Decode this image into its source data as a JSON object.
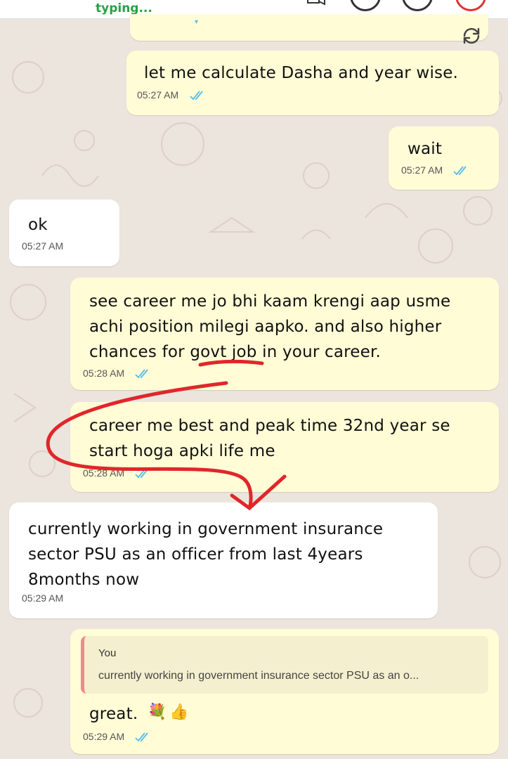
{
  "header": {
    "status": "typing..."
  },
  "colors": {
    "outgoing": "#fffcd6",
    "incoming": "#ffffff",
    "ticks": "#53bdeb",
    "annotation": "#e0262b",
    "typing": "#25a244"
  },
  "messages": [
    {
      "direction": "out",
      "text": "let me calculate Dasha and year wise.",
      "time": "05:27 AM",
      "status": "read"
    },
    {
      "direction": "out",
      "text": "wait",
      "time": "05:27 AM",
      "status": "read"
    },
    {
      "direction": "in",
      "text": "ok",
      "time": "05:27 AM"
    },
    {
      "direction": "out",
      "text": "see career me jo bhi kaam krengi aap usme\nachi position milegi aapko. and also higher\nchances for govt job in your career.",
      "time": "05:28 AM",
      "status": "read"
    },
    {
      "direction": "out",
      "text": "career me best and peak time 32nd year se\nstart hoga apki life me",
      "time": "05:28 AM",
      "status": "read"
    },
    {
      "direction": "in",
      "text": "currently working in government insurance\nsector PSU as an officer from last 4years\n8months now",
      "time": "05:29 AM"
    },
    {
      "direction": "out",
      "reply": {
        "author": "You",
        "text": "currently working in government insurance sector PSU as an o..."
      },
      "text": "great.",
      "emojis": [
        "bouquet-emoji",
        "thumbs-up-emoji"
      ],
      "time": "05:29 AM",
      "status": "read"
    }
  ],
  "icons": [
    "refresh-icon",
    "double-tick-icon"
  ]
}
